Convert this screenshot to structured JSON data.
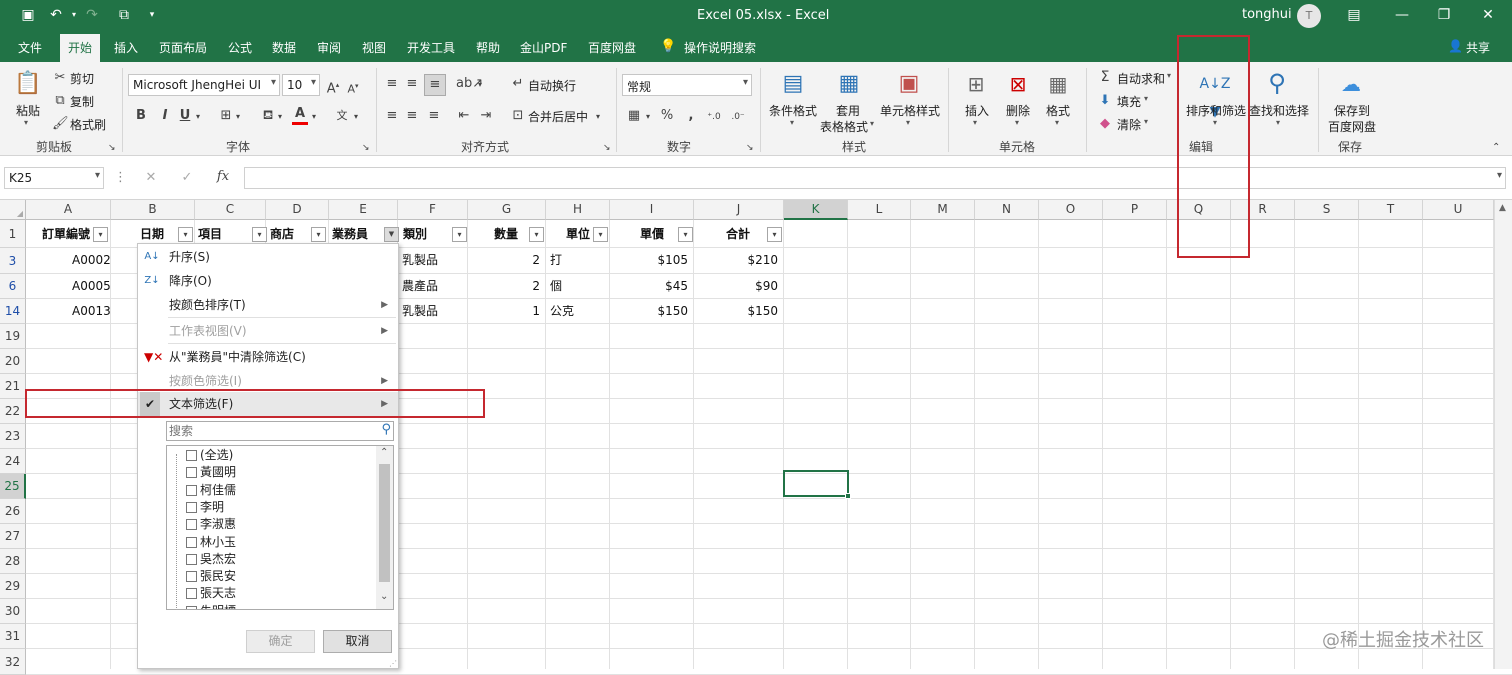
{
  "titlebar": {
    "doc_title": "Excel 05.xlsx  -  Excel",
    "user": "tonghui",
    "avatar_letter": "T"
  },
  "tabs": [
    "文件",
    "开始",
    "插入",
    "页面布局",
    "公式",
    "数据",
    "审阅",
    "视图",
    "开发工具",
    "帮助",
    "金山PDF",
    "百度网盘",
    "操作说明搜索"
  ],
  "share_label": "共享",
  "ribbon": {
    "clipboard": {
      "paste": "粘贴",
      "cut": "剪切",
      "copy": "复制",
      "format_painter": "格式刷",
      "label": "剪贴板"
    },
    "font": {
      "name": "Microsoft JhengHei UI",
      "size": "10",
      "label": "字体"
    },
    "align": {
      "wrap": "自动换行",
      "merge": "合并后居中",
      "label": "对齐方式"
    },
    "number": {
      "format": "常规",
      "label": "数字"
    },
    "styles": {
      "cond": "条件格式",
      "table1": "套用",
      "table2": "表格格式",
      "cellstyle": "单元格样式",
      "label": "样式"
    },
    "cells": {
      "insert": "插入",
      "delete": "删除",
      "format": "格式",
      "label": "单元格"
    },
    "edit": {
      "autosum": "自动求和",
      "fill": "填充",
      "clear": "清除",
      "sortfilter": "排序和筛选",
      "findselect": "查找和选择",
      "label": "编辑"
    },
    "save": {
      "save1": "保存到",
      "save2": "百度网盘",
      "label": "保存"
    }
  },
  "formula_bar": {
    "name_box": "K25",
    "fx": "fx",
    "value": ""
  },
  "columns": [
    "A",
    "B",
    "C",
    "D",
    "E",
    "F",
    "G",
    "H",
    "I",
    "J",
    "K",
    "L",
    "M",
    "N",
    "O",
    "P",
    "Q",
    "R",
    "S",
    "T",
    "U"
  ],
  "rows": [
    "1",
    "3",
    "6",
    "14",
    "19",
    "20",
    "21",
    "22",
    "23",
    "24",
    "25",
    "26",
    "27",
    "28",
    "29",
    "30",
    "31",
    "32"
  ],
  "header_row": [
    "訂單編號",
    "日期",
    "項目",
    "商店",
    "業務員",
    "類別",
    "數量",
    "單位",
    "單價",
    "合計"
  ],
  "data_rows": [
    {
      "A": "A0002",
      "F": "乳製品",
      "G": "2",
      "H": "打",
      "I": "$105",
      "J": "$210"
    },
    {
      "A": "A0005",
      "F": "農產品",
      "G": "2",
      "H": "個",
      "I": "$45",
      "J": "$90"
    },
    {
      "A": "A0013",
      "F": "乳製品",
      "G": "1",
      "H": "公克",
      "I": "$150",
      "J": "$150"
    }
  ],
  "filter_menu": {
    "sort_asc": "升序(S)",
    "sort_desc": "降序(O)",
    "sort_color": "按颜色排序(T)",
    "sheet_view": "工作表视图(V)",
    "clear_filter": "从\"業務員\"中清除筛选(C)",
    "filter_color": "按颜色筛选(I)",
    "text_filter": "文本筛选(F)",
    "search_placeholder": "搜索",
    "items": [
      "(全选)",
      "黃國明",
      "柯佳儒",
      "李明",
      "李淑惠",
      "林小玉",
      "吳杰宏",
      "張民安",
      "張天志",
      "朱明標"
    ],
    "ok": "确定",
    "cancel": "取消"
  },
  "watermark": "@稀土掘金技术社区",
  "colors": {
    "excel_green": "#217346",
    "highlight_red": "#c5282f"
  }
}
